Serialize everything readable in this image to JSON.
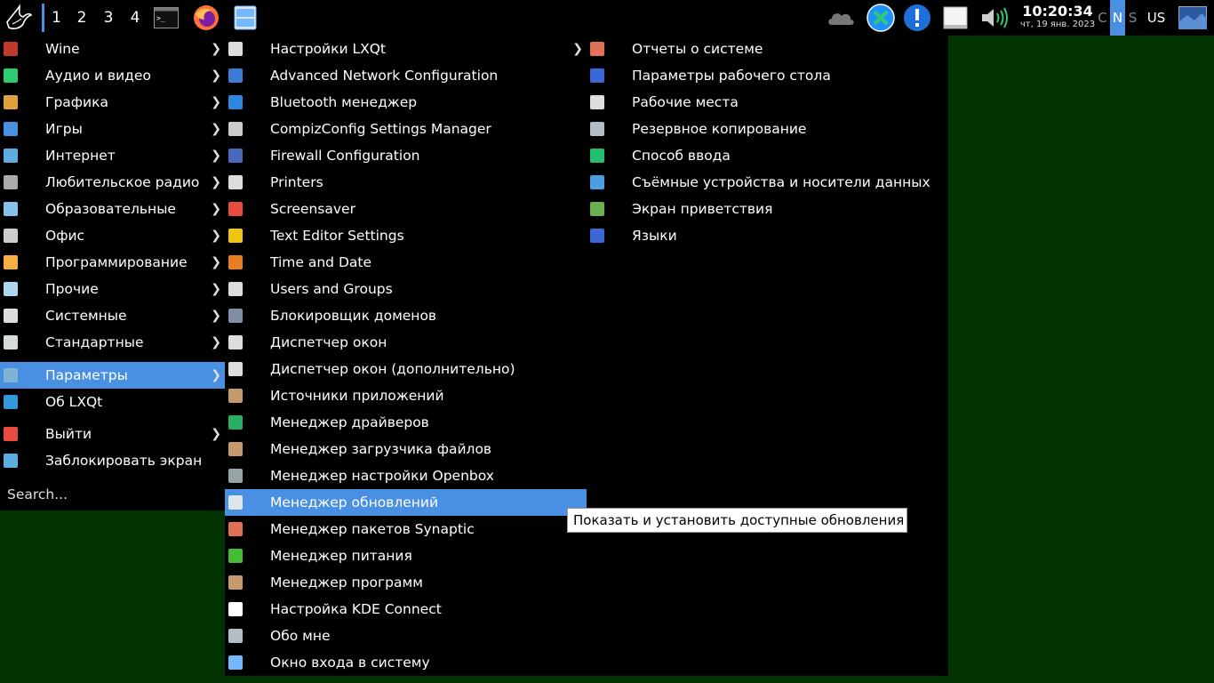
{
  "panel": {
    "desktops": [
      "1",
      "2",
      "3",
      "4"
    ],
    "clock": {
      "time": "10:20:34",
      "date": "чт, 19 янв. 2023"
    },
    "kbd_indicators": [
      "C",
      "N",
      "S"
    ],
    "layout": "US"
  },
  "main_menu": {
    "items": [
      {
        "label": "Wine",
        "icon": "wine-icon",
        "color": "#c0392b"
      },
      {
        "label": "Аудио и видео",
        "icon": "multimedia-icon",
        "color": "#2ecc71"
      },
      {
        "label": "Графика",
        "icon": "graphics-icon",
        "color": "#e0a040"
      },
      {
        "label": "Игры",
        "icon": "games-icon",
        "color": "#4a90e2"
      },
      {
        "label": "Интернет",
        "icon": "internet-icon",
        "color": "#5dade2"
      },
      {
        "label": "Любительское радио",
        "icon": "radio-icon",
        "color": "#aaaaaa"
      },
      {
        "label": "Образовательные",
        "icon": "education-icon",
        "color": "#85c1e9"
      },
      {
        "label": "Офис",
        "icon": "office-icon",
        "color": "#cccccc"
      },
      {
        "label": "Программирование",
        "icon": "programming-icon",
        "color": "#f5b041"
      },
      {
        "label": "Прочие",
        "icon": "other-icon",
        "color": "#aed6f1"
      },
      {
        "label": "Системные",
        "icon": "system-icon",
        "color": "#dddddd"
      },
      {
        "label": "Стандартные",
        "icon": "accessories-icon",
        "color": "#d5dbdb"
      },
      {
        "label": "Параметры",
        "icon": "preferences-icon",
        "color": "#7fb3d5"
      },
      {
        "label": "Об LXQt",
        "icon": "about-icon",
        "color": "#3498db"
      },
      {
        "label": "Выйти",
        "icon": "logout-icon",
        "color": "#e74c3c"
      },
      {
        "label": "Заблокировать экран",
        "icon": "lock-icon",
        "color": "#5dade2"
      }
    ],
    "search_placeholder": "Search..."
  },
  "submenu": {
    "items": [
      {
        "label": "Настройки LXQt",
        "icon": "tools-icon",
        "color": "#dddddd"
      },
      {
        "label": "Advanced Network Configuration",
        "icon": "network-icon",
        "color": "#3a7bd5"
      },
      {
        "label": "Bluetooth менеджер",
        "icon": "bluetooth-icon",
        "color": "#2e86de"
      },
      {
        "label": "CompizConfig Settings Manager",
        "icon": "compiz-icon",
        "color": "#cccccc"
      },
      {
        "label": "Firewall Configuration",
        "icon": "firewall-icon",
        "color": "#4a69bd"
      },
      {
        "label": "Printers",
        "icon": "printer-icon",
        "color": "#dddddd"
      },
      {
        "label": "Screensaver",
        "icon": "screensaver-icon",
        "color": "#e74c3c"
      },
      {
        "label": "Text Editor Settings",
        "icon": "text-editor-icon",
        "color": "#f1c40f"
      },
      {
        "label": "Time and Date",
        "icon": "clock-icon",
        "color": "#e67e22"
      },
      {
        "label": "Users and Groups",
        "icon": "gear-icon",
        "color": "#dddddd"
      },
      {
        "label": "Блокировщик доменов",
        "icon": "domain-blocker-icon",
        "color": "#7f8fa6"
      },
      {
        "label": "Диспетчер окон",
        "icon": "gear-icon",
        "color": "#dddddd"
      },
      {
        "label": "Диспетчер окон (дополнительно)",
        "icon": "gear-icon",
        "color": "#dddddd"
      },
      {
        "label": "Источники приложений",
        "icon": "package-icon",
        "color": "#c49a6c"
      },
      {
        "label": "Менеджер драйверов",
        "icon": "driver-icon",
        "color": "#27ae60"
      },
      {
        "label": "Менеджер загрузчика файлов",
        "icon": "package-icon",
        "color": "#c49a6c"
      },
      {
        "label": "Менеджер настройки Openbox",
        "icon": "openbox-icon",
        "color": "#95a5a6"
      },
      {
        "label": "Менеджер обновлений",
        "icon": "shield-icon",
        "color": "#dfe6e9"
      },
      {
        "label": "Менеджер пакетов Synaptic",
        "icon": "synaptic-icon",
        "color": "#e17055"
      },
      {
        "label": "Менеджер питания",
        "icon": "battery-icon",
        "color": "#44bd32"
      },
      {
        "label": "Менеджер программ",
        "icon": "package-icon",
        "color": "#c49a6c"
      },
      {
        "label": "Настройка KDE Connect",
        "icon": "phone-icon",
        "color": "#ffffff"
      },
      {
        "label": "Обо мне",
        "icon": "user-icon",
        "color": "#b2bec3"
      },
      {
        "label": "Окно входа в систему",
        "icon": "login-window-icon",
        "color": "#74b9ff"
      }
    ]
  },
  "submenu2": {
    "items": [
      {
        "label": "Отчеты о системе",
        "icon": "system-report-icon",
        "color": "#e17055"
      },
      {
        "label": "Параметры рабочего стола",
        "icon": "desktop-icon",
        "color": "#3867d6"
      },
      {
        "label": "Рабочие места",
        "icon": "gear-icon",
        "color": "#dddddd"
      },
      {
        "label": "Резервное копирование",
        "icon": "backup-icon",
        "color": "#b2bec3"
      },
      {
        "label": "Способ ввода",
        "icon": "input-method-icon",
        "color": "#20bf6b"
      },
      {
        "label": "Съёмные устройства и носители данных",
        "icon": "usb-icon",
        "color": "#4b9fe1"
      },
      {
        "label": "Экран приветствия",
        "icon": "welcome-icon",
        "color": "#6ab04c"
      },
      {
        "label": "Языки",
        "icon": "languages-icon",
        "color": "#3867d6"
      }
    ]
  },
  "tooltip": "Показать и установить доступные обновления"
}
